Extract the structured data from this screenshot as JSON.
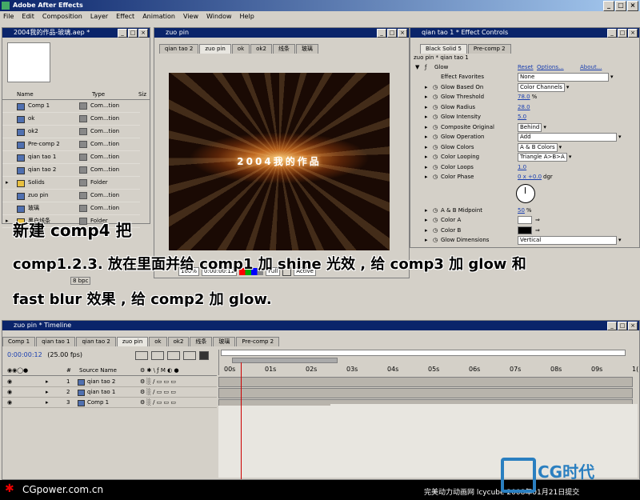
{
  "app": {
    "title": "Adobe After Effects"
  },
  "menu": [
    "File",
    "Edit",
    "Composition",
    "Layer",
    "Effect",
    "Animation",
    "View",
    "Window",
    "Help"
  ],
  "project": {
    "title": "2004我的作品-玻璃.aep *",
    "columns": [
      "Name",
      "Type",
      "Siz"
    ],
    "items": [
      {
        "name": "Comp 1",
        "type": "Com...tion",
        "kind": "comp"
      },
      {
        "name": "ok",
        "type": "Com...tion",
        "kind": "comp"
      },
      {
        "name": "ok2",
        "type": "Com...tion",
        "kind": "comp"
      },
      {
        "name": "Pre-comp 2",
        "type": "Com...tion",
        "kind": "comp"
      },
      {
        "name": "qian tao 1",
        "type": "Com...tion",
        "kind": "comp"
      },
      {
        "name": "qian tao 2",
        "type": "Com...tion",
        "kind": "comp"
      },
      {
        "name": "Solids",
        "type": "Folder",
        "kind": "folder"
      },
      {
        "name": "zuo pin",
        "type": "Com...tion",
        "kind": "comp"
      },
      {
        "name": "玻璃",
        "type": "Com...tion",
        "kind": "comp"
      },
      {
        "name": "黑白线条",
        "type": "Folder",
        "kind": "folder"
      }
    ],
    "bpc": "8 bpc"
  },
  "comp_window": {
    "title": "zuo pin",
    "tabs": [
      "qian tao 2",
      "zuo pin",
      "ok",
      "ok2",
      "线条",
      "玻璃"
    ],
    "active_tab": 1,
    "preview_text": "2004我的作品",
    "zoom": "100%",
    "timecode": "0:00:00:12",
    "resolution": "Full",
    "active_label": "Active"
  },
  "effect_controls": {
    "title": "qian tao 1 * Effect Controls",
    "tabs": [
      "Black Solid 5",
      "Pre-comp 2"
    ],
    "breadcrumb": "zuo pin * qian tao 1",
    "effect_name": "Glow",
    "reset": "Reset",
    "options": "Options...",
    "about": "About...",
    "params": [
      {
        "label": "Effect Favorites",
        "value": "None",
        "kind": "dd"
      },
      {
        "label": "Glow Based On",
        "value": "Color Channels",
        "kind": "dd"
      },
      {
        "label": "Glow Threshold",
        "value": "78.0",
        "unit": "%",
        "kind": "num"
      },
      {
        "label": "Glow Radius",
        "value": "28.0",
        "kind": "num"
      },
      {
        "label": "Glow Intensity",
        "value": "5.0",
        "kind": "num"
      },
      {
        "label": "Composite Original",
        "value": "Behind",
        "kind": "dd"
      },
      {
        "label": "Glow Operation",
        "value": "Add",
        "kind": "dd"
      },
      {
        "label": "Glow Colors",
        "value": "A & B Colors",
        "kind": "dd"
      },
      {
        "label": "Color Looping",
        "value": "Triangle A>B>A",
        "kind": "dd"
      },
      {
        "label": "Color Loops",
        "value": "1.0",
        "kind": "num"
      },
      {
        "label": "Color Phase",
        "value": "0 x +0.0",
        "unit": "dgr",
        "kind": "num"
      }
    ],
    "params2": [
      {
        "label": "A & B Midpoint",
        "value": "50",
        "unit": "%",
        "kind": "num"
      },
      {
        "label": "Color A",
        "kind": "color",
        "color": "#ffffff"
      },
      {
        "label": "Color B",
        "kind": "color",
        "color": "#000000"
      },
      {
        "label": "Glow Dimensions",
        "value": "Vertical",
        "kind": "dd"
      }
    ]
  },
  "overlay": {
    "line1": "新建 comp4 把",
    "line2": "comp1.2.3. 放在里面并给 comp1 加 shine 光效 , 给 comp3 加 glow 和",
    "line3": "fast blur 效果 , 给 comp2 加 glow."
  },
  "timeline": {
    "title": "zuo pin * Timeline",
    "tabs": [
      "Comp 1",
      "qian tao 1",
      "qian tao 2",
      "zuo pin",
      "ok",
      "ok2",
      "线条",
      "玻璃",
      "Pre-comp 2"
    ],
    "active_tab": 3,
    "timecode": "0:00:00:12",
    "fps": "(25.00 fps)",
    "col_num": "#",
    "col_source": "Source Name",
    "ruler": [
      "00s",
      "01s",
      "02s",
      "03s",
      "04s",
      "05s",
      "06s",
      "07s",
      "08s",
      "09s",
      "1("
    ],
    "layers": [
      {
        "num": "1",
        "name": "qian tao 2"
      },
      {
        "num": "2",
        "name": "qian tao 1"
      },
      {
        "num": "3",
        "name": "Comp 1"
      }
    ]
  },
  "footer": {
    "left": "CGpower.com.cn",
    "right": "完美动力动画网 lcycube 2008年01月21日提交",
    "logo": "CG时代"
  }
}
